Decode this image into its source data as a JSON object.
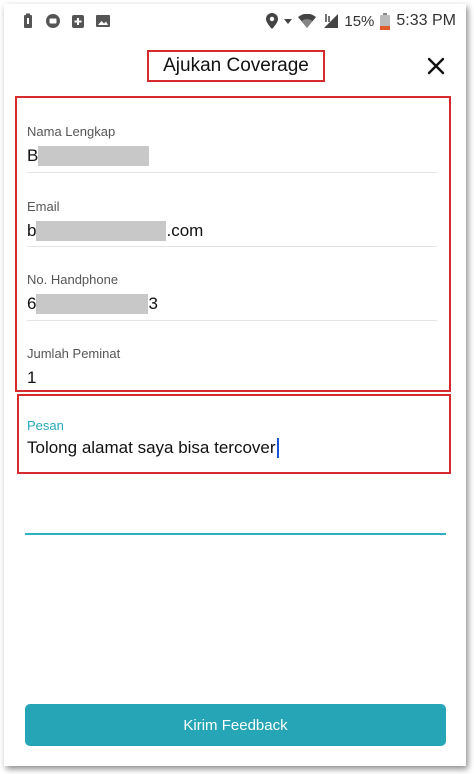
{
  "status_bar": {
    "battery_percent": "15%",
    "time": "5:33 PM",
    "icons": [
      "battery-saver-icon",
      "chat-icon",
      "plus-box-icon",
      "image-icon",
      "location-icon",
      "wifi-icon",
      "signal-icon",
      "battery-low-icon"
    ]
  },
  "header": {
    "title": "Ajukan Coverage",
    "close_icon": "close-icon"
  },
  "form": {
    "nama": {
      "label": "Nama Lengkap",
      "value_prefix": "B",
      "value_suffix": ""
    },
    "email": {
      "label": "Email",
      "value_prefix": "b",
      "value_suffix": ".com"
    },
    "phone": {
      "label": "No. Handphone",
      "value_prefix": "6",
      "value_suffix": "3"
    },
    "peminat": {
      "label": "Jumlah Peminat",
      "value": "1"
    },
    "pesan": {
      "label": "Pesan",
      "value": "Tolong alamat saya bisa tercover"
    }
  },
  "submit_label": "Kirim Feedback",
  "colors": {
    "accent": "#26a5b6",
    "highlight_border": "#d62b2b",
    "caret": "#1a57d8"
  }
}
